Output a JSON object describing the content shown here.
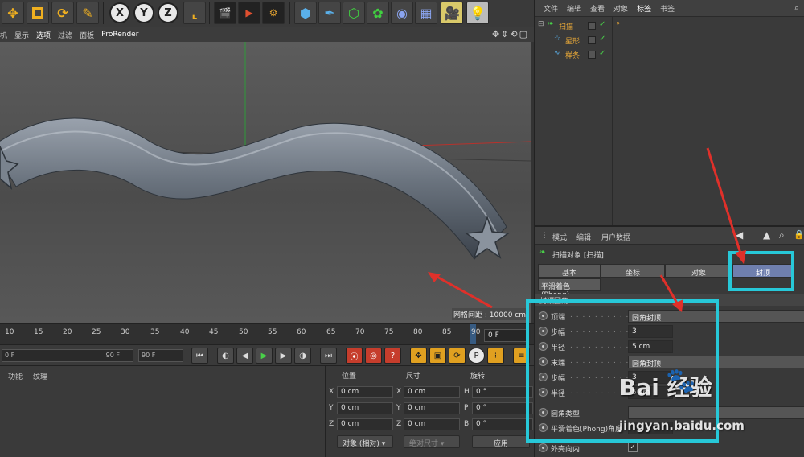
{
  "toolbar": {
    "icons": [
      "move-icon",
      "scale-icon",
      "rotate-icon",
      "live-select-icon",
      "x-axis-icon",
      "y-axis-icon",
      "z-axis-icon",
      "coordinate-system-icon",
      "render-view-icon",
      "render-picture-queue-icon",
      "render-settings-icon",
      "cube-icon",
      "pen-icon",
      "subdivision-icon",
      "cloner-icon",
      "deformer-icon",
      "floor-icon",
      "camera-icon",
      "light-icon"
    ],
    "axis_x": "X",
    "axis_y": "Y",
    "axis_z": "Z"
  },
  "viewport_menu": {
    "items": [
      "机",
      "显示",
      "选项",
      "过滤",
      "面板",
      "ProRender"
    ],
    "grid_spacing": "网格间距 : 10000 cm"
  },
  "timeline": {
    "ticks": [
      "10",
      "15",
      "20",
      "25",
      "30",
      "35",
      "40",
      "45",
      "50",
      "55",
      "60",
      "65",
      "70",
      "75",
      "80",
      "85",
      "90"
    ],
    "current_frame": "0 F"
  },
  "transport": {
    "start_frame": "0 F",
    "end_frame_slider": "90 F",
    "end_frame": "90 F"
  },
  "bottom_left": {
    "tabs": [
      "功能",
      "纹理"
    ]
  },
  "coordinates": {
    "headers": {
      "position": "位置",
      "size": "尺寸",
      "rotation": "旋转"
    },
    "rows": [
      {
        "axis": "X",
        "pos": "0 cm",
        "size_axis": "X",
        "size": "0 cm",
        "rot_axis": "H",
        "rot": "0 °"
      },
      {
        "axis": "Y",
        "pos": "0 cm",
        "size_axis": "Y",
        "size": "0 cm",
        "rot_axis": "P",
        "rot": "0 °"
      },
      {
        "axis": "Z",
        "pos": "0 cm",
        "size_axis": "Z",
        "size": "0 cm",
        "rot_axis": "B",
        "rot": "0 °"
      }
    ],
    "mode_select": "对象 (相对)",
    "size_select": "绝对尺寸",
    "apply": "应用"
  },
  "object_manager": {
    "menu": [
      "文件",
      "编辑",
      "查看",
      "对象",
      "标签",
      "书签"
    ],
    "objects": [
      {
        "name": "扫描"
      },
      {
        "name": "星形"
      },
      {
        "name": "样条"
      }
    ]
  },
  "attribute_manager": {
    "menu": [
      "模式",
      "编辑",
      "用户数据"
    ],
    "title": "扫描对象 [扫描]",
    "tabs": [
      "基本",
      "坐标",
      "对象",
      "封顶"
    ],
    "active_tab": "封顶",
    "tab2": "平滑着色(Phong)",
    "section": "封顶圆角",
    "props": [
      {
        "label": "顶端",
        "value": "圆角封顶",
        "kind": "dd"
      },
      {
        "label": "步幅",
        "value": "3",
        "kind": "num"
      },
      {
        "label": "半径",
        "value": "5 cm",
        "kind": "num"
      },
      {
        "label": "末端",
        "value": "圆角封顶",
        "kind": "dd"
      },
      {
        "label": "步幅",
        "value": "3",
        "kind": "num"
      },
      {
        "label": "半径",
        "value": "5 cm",
        "kind": "num"
      },
      {
        "label": "圆角类型",
        "value": "",
        "kind": "dd"
      },
      {
        "label": "平滑着色(Phong)角度",
        "value": "",
        "kind": "num"
      },
      {
        "label": "外壳向内",
        "value": "✓",
        "kind": "check"
      }
    ]
  },
  "watermark": {
    "brand": "Bai  经验",
    "url": "jingyan.baidu.com"
  },
  "colors": {
    "highlight_box": "#27c8d8",
    "arrow": "#e0302a",
    "active_tab": "#6f7fae",
    "object_name": "#e8a838"
  }
}
